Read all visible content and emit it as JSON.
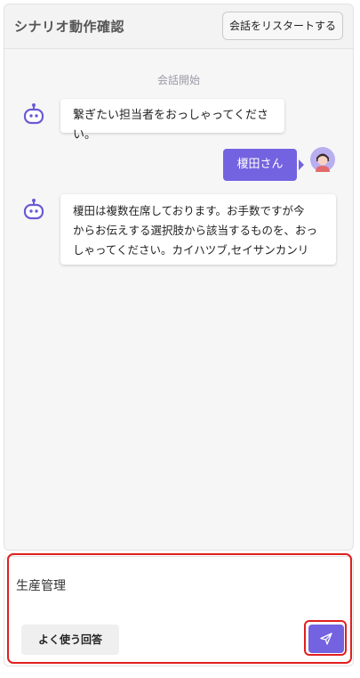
{
  "header": {
    "title": "シナリオ動作確認",
    "restart_label": "会話をリスタートする"
  },
  "chat": {
    "start_label": "会話開始",
    "messages": [
      {
        "role": "bot",
        "text": "繋ぎたい担当者をおっしゃってください。"
      },
      {
        "role": "user",
        "text": "榎田さん"
      },
      {
        "role": "bot",
        "lines": [
          "榎田は複数在席しております。お手数ですが今",
          "からお伝えする選択肢から該当するものを、おっ",
          "しゃってください。カイハツブ,セイサンカンリ"
        ]
      }
    ]
  },
  "composer": {
    "input_value": "生産管理",
    "faq_label": "よく使う回答"
  },
  "colors": {
    "accent": "#7363e0",
    "highlight": "#e0201e"
  },
  "icons": {
    "bot": "robot-icon",
    "user": "user-avatar",
    "send": "send-icon"
  }
}
